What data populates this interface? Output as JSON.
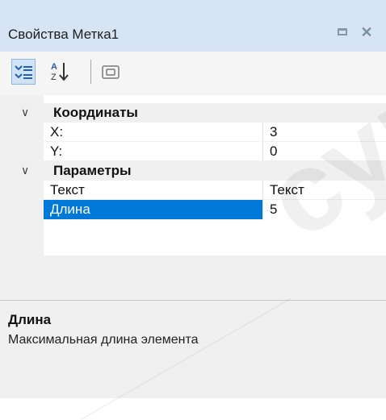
{
  "window": {
    "title": "Свойства Метка1"
  },
  "toolbar": {
    "buttons": [
      {
        "icon": "categorized-icon",
        "active": true
      },
      {
        "icon": "sort-alphabetical-icon",
        "active": false
      },
      {
        "icon": "property-pages-icon",
        "active": false
      }
    ]
  },
  "grid": {
    "categories": [
      {
        "label": "Координаты",
        "expanded": true,
        "properties": [
          {
            "name": "X:",
            "value": "3"
          },
          {
            "name": "Y:",
            "value": "0"
          }
        ]
      },
      {
        "label": "Параметры",
        "expanded": true,
        "properties": [
          {
            "name": "Текст",
            "value": "Текст"
          },
          {
            "name": "Длина",
            "value": "5",
            "selected": true
          }
        ]
      }
    ]
  },
  "description": {
    "title": "Длина",
    "text": "Максимальная длина элемента"
  },
  "watermark": {
    "text": "супер"
  },
  "colors": {
    "selection": "#0078d7",
    "titlebar": "#d6e4f4"
  }
}
